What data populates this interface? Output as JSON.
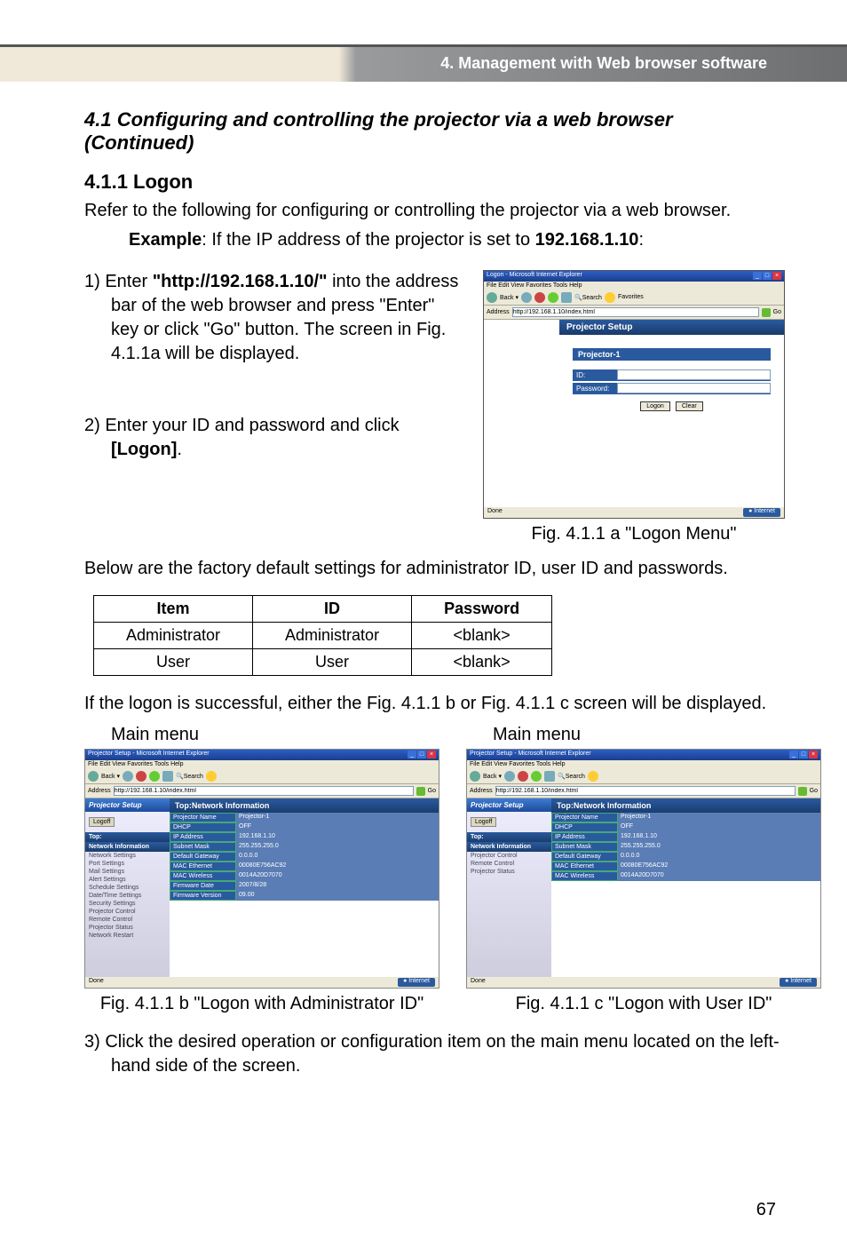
{
  "header_bar": "4. Management with Web browser software",
  "section_title": "4.1 Configuring and controlling the projector via a web browser (Continued)",
  "sub_title": "4.1.1 Logon",
  "intro_line": "Refer to the following for configuring or controlling the projector via a web browser.",
  "example_label": "Example",
  "example_rest": ": If the IP address of the projector is set to ",
  "example_ip": "192.168.1.10",
  "example_colon_end": ":",
  "step1_prefix": "1) Enter ",
  "step1_url": "\"http://192.168.1.10/\"",
  "step1_rest": " into the address bar of the web browser and press \"Enter\" key or click \"Go\" button.  The screen in Fig. 4.1.1a will be displayed.",
  "step2_prefix": "2) Enter your ID and password and click ",
  "step2_logon": "[Logon]",
  "step2_period": ".",
  "fig_a_caption": "Fig. 4.1.1 a \"Logon Menu\"",
  "below_text": "Below are the factory default settings for administrator ID, user ID and passwords.",
  "table": {
    "headers": [
      "Item",
      "ID",
      "Password"
    ],
    "rows": [
      [
        "Administrator",
        "Administrator",
        "<blank>"
      ],
      [
        "User",
        "User",
        "<blank>"
      ]
    ]
  },
  "success_text": "If the logon is successful, either the Fig. 4.1.1 b or Fig. 4.1.1 c screen will be displayed.",
  "main_menu_label": "Main menu",
  "fig_b_caption": "Fig. 4.1.1 b \"Logon with Administrator ID\"",
  "fig_c_caption": "Fig. 4.1.1 c \"Logon with User ID\"",
  "step3_text": "3) Click the desired operation or configuration item on the main menu located on the left-hand side of the screen.",
  "page_number": "67",
  "logon_shot": {
    "title": "Logon - Microsoft Internet Explorer",
    "menubar": "File  Edit  View  Favorites  Tools  Help",
    "address": "http://192.168.1.10/index.html",
    "ps_header": "Projector Setup",
    "projector_name": "Projector-1",
    "id_label": "ID:",
    "pw_label": "Password:",
    "logon_btn": "Logon",
    "clear_btn": "Clear",
    "status_left": "Done",
    "status_right": "Internet"
  },
  "admin_shot": {
    "title": "Projector Setup - Microsoft Internet Explorer",
    "menubar": "File  Edit  View  Favorites  Tools  Help",
    "sidebar_header": "Projector Setup",
    "logoff": "Logoff",
    "sidebar_top": "Top:",
    "sidebar_net_hdr": "Network Information",
    "sidebar_items": [
      "Network Settings",
      "Port Settings",
      "Mail Settings",
      "Alert Settings",
      "Schedule Settings",
      "Date/Time Settings",
      "Security Settings",
      "Projector Control",
      "Remote Control",
      "Projector Status",
      "Network Restart"
    ],
    "main_header": "Top:Network Information",
    "rows": [
      {
        "l": "Projector Name",
        "v": "Projector-1"
      },
      {
        "l": "DHCP",
        "v": "OFF"
      },
      {
        "l": "IP Address",
        "v": "192.168.1.10"
      },
      {
        "l": "Subnet Mask",
        "v": "255.255.255.0"
      },
      {
        "l": "Default Gateway",
        "v": "0.0.0.0"
      },
      {
        "l": "MAC Ethernet",
        "v": "00080E756AC92"
      },
      {
        "l": "MAC Wireless",
        "v": "0014A20D7070"
      },
      {
        "l": "Firmware Date",
        "v": "2007/8/28"
      },
      {
        "l": "Firmware Version",
        "v": "09.00"
      }
    ]
  },
  "user_shot": {
    "title": "Projector Setup - Microsoft Internet Explorer",
    "sidebar_items": [
      "Projector Control",
      "Remote Control",
      "Projector Status"
    ],
    "rows": [
      {
        "l": "Projector Name",
        "v": "Projector-1"
      },
      {
        "l": "DHCP",
        "v": "OFF"
      },
      {
        "l": "IP Address",
        "v": "192.168.1.10"
      },
      {
        "l": "Subnet Mask",
        "v": "255.255.255.0"
      },
      {
        "l": "Default Gateway",
        "v": "0.0.0.0"
      },
      {
        "l": "MAC Ethernet",
        "v": "00080E756AC92"
      },
      {
        "l": "MAC Wireless",
        "v": "0014A20D7070"
      }
    ]
  }
}
